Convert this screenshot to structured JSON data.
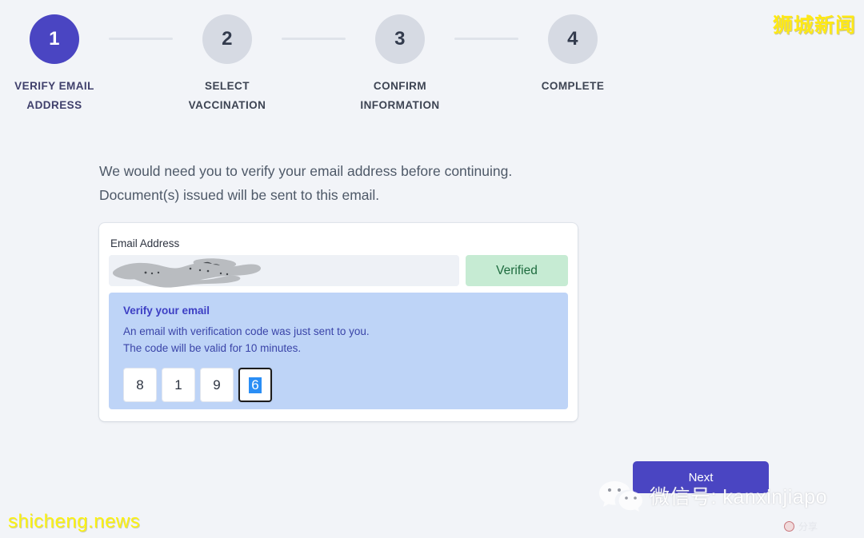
{
  "stepper": {
    "steps": [
      {
        "number": "1",
        "label_line1": "VERIFY EMAIL",
        "label_line2": "ADDRESS",
        "state": "active"
      },
      {
        "number": "2",
        "label_line1": "SELECT",
        "label_line2": "VACCINATION",
        "state": "inactive"
      },
      {
        "number": "3",
        "label_line1": "CONFIRM",
        "label_line2": "INFORMATION",
        "state": "inactive"
      },
      {
        "number": "4",
        "label_line1": "COMPLETE",
        "label_line2": "",
        "state": "inactive"
      }
    ],
    "active_color": "#4a45c2",
    "inactive_color": "#d6dae3"
  },
  "intro": {
    "line1": "We would need you to verify your email address before continuing.",
    "line2": "Document(s) issued will be sent to this email."
  },
  "form": {
    "email_label": "Email Address",
    "email_value": "",
    "email_redacted": true,
    "verified_badge": "Verified",
    "verified_bg": "#c6ebd3",
    "verified_text_color": "#1d6b3e"
  },
  "verify_panel": {
    "title": "Verify your email",
    "line1": "An email with verification code was just sent to you.",
    "line2": "The code will be valid for 10 minutes.",
    "background": "#bed4f7",
    "otp": {
      "digits": [
        "8",
        "1",
        "9",
        "6"
      ],
      "focused_index": 3,
      "selection_color": "#2a8ef5"
    }
  },
  "actions": {
    "next_label": "Next",
    "next_color": "#4a45c2"
  },
  "watermarks": {
    "top_right": "狮城新闻",
    "bottom_left": "shicheng.news",
    "wechat": "微信号: kanxinjiapo",
    "share_hint": "分享",
    "yellow": "#fbf211"
  }
}
